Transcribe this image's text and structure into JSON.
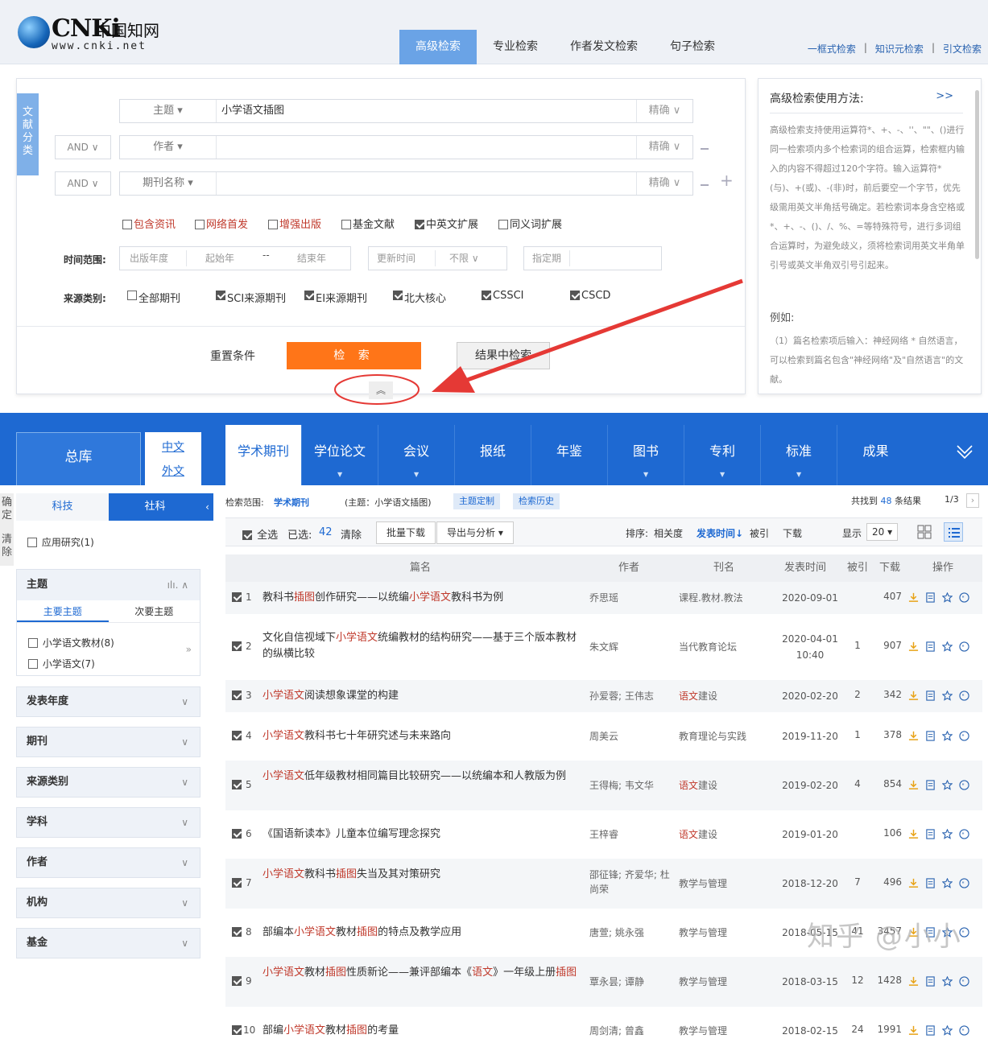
{
  "logo": {
    "text": "CNKi",
    "cn": "中国知网",
    "url": "www.cnki.net"
  },
  "top_tabs": [
    "高级检索",
    "专业检索",
    "作者发文检索",
    "句子检索"
  ],
  "top_links": [
    "一框式检索",
    "知识元检索",
    "引文检索"
  ],
  "side_tag": "文献分类",
  "search_rows": [
    {
      "logic": "",
      "field": "主题",
      "value": "小学语文插图",
      "precision": "精确"
    },
    {
      "logic": "AND",
      "field": "作者",
      "value": "",
      "precision": "精确"
    },
    {
      "logic": "AND",
      "field": "期刊名称",
      "value": "",
      "precision": "精确"
    }
  ],
  "options": [
    {
      "label": "包含资讯",
      "checked": false,
      "red": true
    },
    {
      "label": "网络首发",
      "checked": false,
      "red": true
    },
    {
      "label": "增强出版",
      "checked": false,
      "red": true
    },
    {
      "label": "基金文献",
      "checked": false,
      "red": false
    },
    {
      "label": "中英文扩展",
      "checked": true,
      "red": false
    },
    {
      "label": "同义词扩展",
      "checked": false,
      "red": false
    }
  ],
  "time": {
    "label": "时间范围:",
    "pub": "出版年度",
    "start": "起始年",
    "dash": "--",
    "end": "结束年",
    "update": "更新时间",
    "unlimited": "不限",
    "specify": "指定期"
  },
  "source": {
    "label": "来源类别:",
    "items": [
      {
        "label": "全部期刊",
        "checked": false
      },
      {
        "label": "SCI来源期刊",
        "checked": true
      },
      {
        "label": "EI来源期刊",
        "checked": true
      },
      {
        "label": "北大核心",
        "checked": true
      },
      {
        "label": "CSSCI",
        "checked": true
      },
      {
        "label": "CSCD",
        "checked": true
      }
    ]
  },
  "buttons": {
    "reset": "重置条件",
    "search": "检 索",
    "within": "结果中检索",
    "collapse": "︽"
  },
  "help": {
    "title": "高级检索使用方法:",
    "more": ">>",
    "body": "高级检索支持使用运算符*、+、-、''、\"\"、()进行同一检索项内多个检索词的组合运算，检索框内输入的内容不得超过120个字符。输入运算符*(与)、+(或)、-(非)时，前后要空一个字节，优先级需用英文半角括号确定。若检索词本身含空格或*、+、-、()、/、%、=等特殊符号，进行多词组合运算时，为避免歧义，须将检索词用英文半角单引号或英文半角双引号引起来。",
    "ex_title": "例如:",
    "ex_body": "（1）篇名检索项后输入：神经网络 * 自然语言，可以检索到篇名包含\"神经网络\"及\"自然语言\"的文献。"
  },
  "db": {
    "all": "总库",
    "zh": "中文",
    "en": "外文",
    "tabs": [
      "学术期刊",
      "学位论文",
      "会议",
      "报纸",
      "年鉴",
      "图书",
      "专利",
      "标准",
      "成果"
    ]
  },
  "left": {
    "confirm": "确定",
    "clear": "清除",
    "tab1": "科技",
    "tab2": "社科",
    "item": "应用研究(1)",
    "topic": "主题",
    "topic_tab1": "主要主题",
    "topic_tab2": "次要主题",
    "topic_items": [
      "小学语文教材(8)",
      "小学语文(7)"
    ],
    "topic_more": "»",
    "groups": [
      "发表年度",
      "期刊",
      "来源类别",
      "学科",
      "作者",
      "机构",
      "基金"
    ]
  },
  "results": {
    "scope_label": "检索范围:",
    "scope": "学术期刊",
    "query": "(主题：小学语文插图)",
    "custom": "主题定制",
    "history": "检索历史",
    "found_pre": "共找到",
    "found_num": "48",
    "found_post": "条结果",
    "page": "1/3",
    "select_all": "全选",
    "selected_label": "已选:",
    "selected": "42",
    "clear": "清除",
    "batch": "批量下载",
    "export": "导出与分析",
    "sort_label": "排序:",
    "sort_rel": "相关度",
    "sort_time": "发表时间",
    "sort_cite": "被引",
    "sort_dl": "下载",
    "show": "显示",
    "per_page": "20",
    "headers": [
      "篇名",
      "作者",
      "刊名",
      "发表时间",
      "被引",
      "下载",
      "操作"
    ],
    "rows": [
      {
        "n": "1",
        "parts": [
          [
            "教科书",
            0
          ],
          [
            "插图",
            1
          ],
          [
            "创作研究——以统编",
            0
          ],
          [
            "小学语文",
            1
          ],
          [
            "教科书为例",
            0
          ]
        ],
        "author": "乔思瑶",
        "journal": [
          [
            "课程.教材.教法",
            0
          ]
        ],
        "date": "2020-09-01",
        "cite": "",
        "dl": "407"
      },
      {
        "n": "2",
        "parts": [
          [
            "文化自信视域下",
            0
          ],
          [
            "小学语文",
            1
          ],
          [
            "统编教材的结构研究——基于三个版本教材的纵横比较",
            0
          ]
        ],
        "author": "朱文辉",
        "journal": [
          [
            "当代教育论坛",
            0
          ]
        ],
        "date": "2020-04-01 10:40",
        "cite": "1",
        "dl": "907"
      },
      {
        "n": "3",
        "parts": [
          [
            "小学语文",
            1
          ],
          [
            "阅读想象课堂的构建",
            0
          ]
        ],
        "author": "孙爱蓉; 王伟志",
        "journal": [
          [
            "语文",
            1
          ],
          [
            "建设",
            0
          ]
        ],
        "date": "2020-02-20",
        "cite": "2",
        "dl": "342"
      },
      {
        "n": "4",
        "parts": [
          [
            "小学语文",
            1
          ],
          [
            "教科书七十年研究述与未来路向",
            0
          ]
        ],
        "author": "周美云",
        "journal": [
          [
            "教育理论与实践",
            0
          ]
        ],
        "date": "2019-11-20",
        "cite": "1",
        "dl": "378"
      },
      {
        "n": "5",
        "parts": [
          [
            "小学语文",
            1
          ],
          [
            "低年级教材相同篇目比较研究——以统编本和人教版为例",
            0
          ]
        ],
        "author": "王得梅; 韦文华",
        "journal": [
          [
            "语文",
            1
          ],
          [
            "建设",
            0
          ]
        ],
        "date": "2019-02-20",
        "cite": "4",
        "dl": "854"
      },
      {
        "n": "6",
        "parts": [
          [
            "《国语新读本》儿童本位编写理念探究",
            0
          ]
        ],
        "author": "王梓睿",
        "journal": [
          [
            "语文",
            1
          ],
          [
            "建设",
            0
          ]
        ],
        "date": "2019-01-20",
        "cite": "",
        "dl": "106"
      },
      {
        "n": "7",
        "parts": [
          [
            "小学语文",
            1
          ],
          [
            "教科书",
            0
          ],
          [
            "插图",
            1
          ],
          [
            "失当及其对策研究",
            0
          ]
        ],
        "author": "邵征锋; 齐爱华; 杜尚荣",
        "journal": [
          [
            "教学与管理",
            0
          ]
        ],
        "date": "2018-12-20",
        "cite": "7",
        "dl": "496"
      },
      {
        "n": "8",
        "parts": [
          [
            "部编本",
            0
          ],
          [
            "小学语文",
            1
          ],
          [
            "教材",
            0
          ],
          [
            "插图",
            1
          ],
          [
            "的特点及教学应用",
            0
          ]
        ],
        "author": "唐萱; 姚永强",
        "journal": [
          [
            "教学与管理",
            0
          ]
        ],
        "date": "2018-05-15",
        "cite": "41",
        "dl": "3457"
      },
      {
        "n": "9",
        "parts": [
          [
            "小学语文",
            1
          ],
          [
            "教材",
            0
          ],
          [
            "插图",
            1
          ],
          [
            "性质新论——兼评部编本《",
            0
          ],
          [
            "语文",
            1
          ],
          [
            "》一年级上册",
            0
          ],
          [
            "插图",
            1
          ]
        ],
        "author": "覃永昙; 谭静",
        "journal": [
          [
            "教学与管理",
            0
          ]
        ],
        "date": "2018-03-15",
        "cite": "12",
        "dl": "1428"
      },
      {
        "n": "10",
        "parts": [
          [
            "部编",
            0
          ],
          [
            "小学语文",
            1
          ],
          [
            "教材",
            0
          ],
          [
            "插图",
            1
          ],
          [
            "的考量",
            0
          ]
        ],
        "author": "周剑清; 曾鑫",
        "journal": [
          [
            "教学与管理",
            0
          ]
        ],
        "date": "2018-02-15",
        "cite": "24",
        "dl": "1991"
      }
    ]
  },
  "watermark": "知乎 @小小",
  "colors": {
    "accent": "#1e69d2",
    "orange": "#ff7518",
    "highlight": "#c0392b",
    "annotation": "#e53935"
  }
}
